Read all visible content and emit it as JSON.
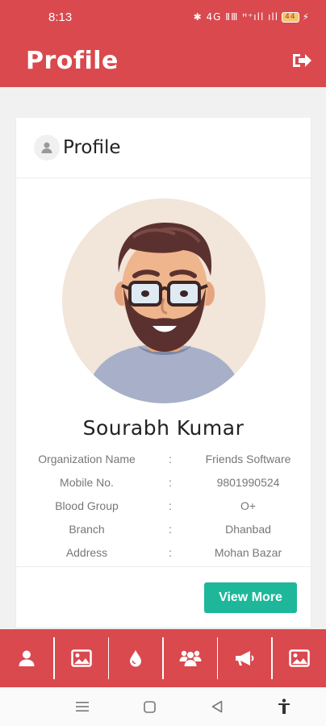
{
  "status_bar": {
    "time": "8:13",
    "icons_text": "✱ 4G ⅡⅢ ᴴ⁺ıll ıll",
    "battery": "44"
  },
  "app_bar": {
    "title": "Profile"
  },
  "card": {
    "title": "Profile",
    "name": "Sourabh Kumar",
    "details": [
      {
        "label": "Organization Name",
        "separator": ":",
        "value": "Friends Software"
      },
      {
        "label": "Mobile No.",
        "separator": ":",
        "value": "9801990524"
      },
      {
        "label": "Blood Group",
        "separator": ":",
        "value": "O+"
      },
      {
        "label": "Branch",
        "separator": ":",
        "value": "Dhanbad"
      },
      {
        "label": "Address",
        "separator": ":",
        "value": "Mohan Bazar"
      }
    ],
    "view_more_label": "View More"
  },
  "bottom_nav": {
    "items": [
      "user-icon",
      "image-icon",
      "blood-drop-icon",
      "group-icon",
      "megaphone-icon",
      "gallery-icon"
    ]
  },
  "colors": {
    "primary": "#d9494e",
    "accent": "#1fb79a",
    "avatar_bg": "#f2e5da"
  }
}
